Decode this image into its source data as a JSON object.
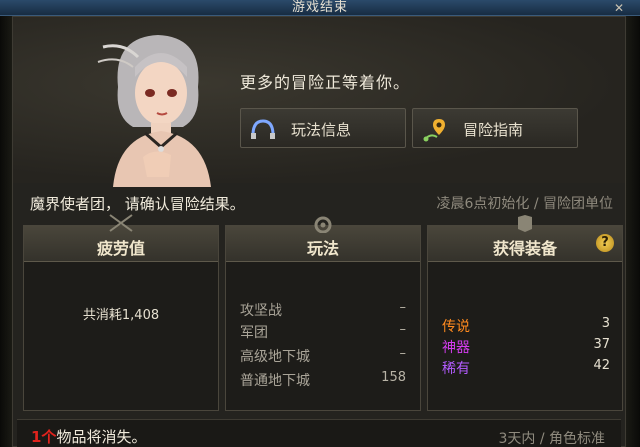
{
  "window": {
    "title": "游戏结束",
    "close": "✕"
  },
  "npc": {
    "message": "更多的冒险正等着你。"
  },
  "buttons": {
    "gameplay_info": "玩法信息",
    "adventure_guide": "冒险指南"
  },
  "confirm": {
    "text": "魔界使者团， 请确认冒险结果。",
    "reset_info": "凌晨6点初始化 / 冒险团单位"
  },
  "fatigue": {
    "title": "疲劳值",
    "consumed": "共消耗1,408"
  },
  "gameplay": {
    "title": "玩法",
    "rows": [
      {
        "name": "攻坚战",
        "value": "–"
      },
      {
        "name": "军团",
        "value": "–"
      },
      {
        "name": "高级地下城",
        "value": "–"
      },
      {
        "name": "普通地下城",
        "value": "158"
      }
    ]
  },
  "equipment": {
    "title": "获得装备",
    "help": "?",
    "rows": [
      {
        "name": "传说",
        "value": "3",
        "color": "#ff8a1e"
      },
      {
        "name": "神器",
        "value": "37",
        "color": "#d43cf0"
      },
      {
        "name": "稀有",
        "value": "42",
        "color": "#b35cff"
      }
    ]
  },
  "loss": {
    "count": "1个",
    "text": "物品将消失。",
    "info": "3天内 / 角色标准"
  }
}
